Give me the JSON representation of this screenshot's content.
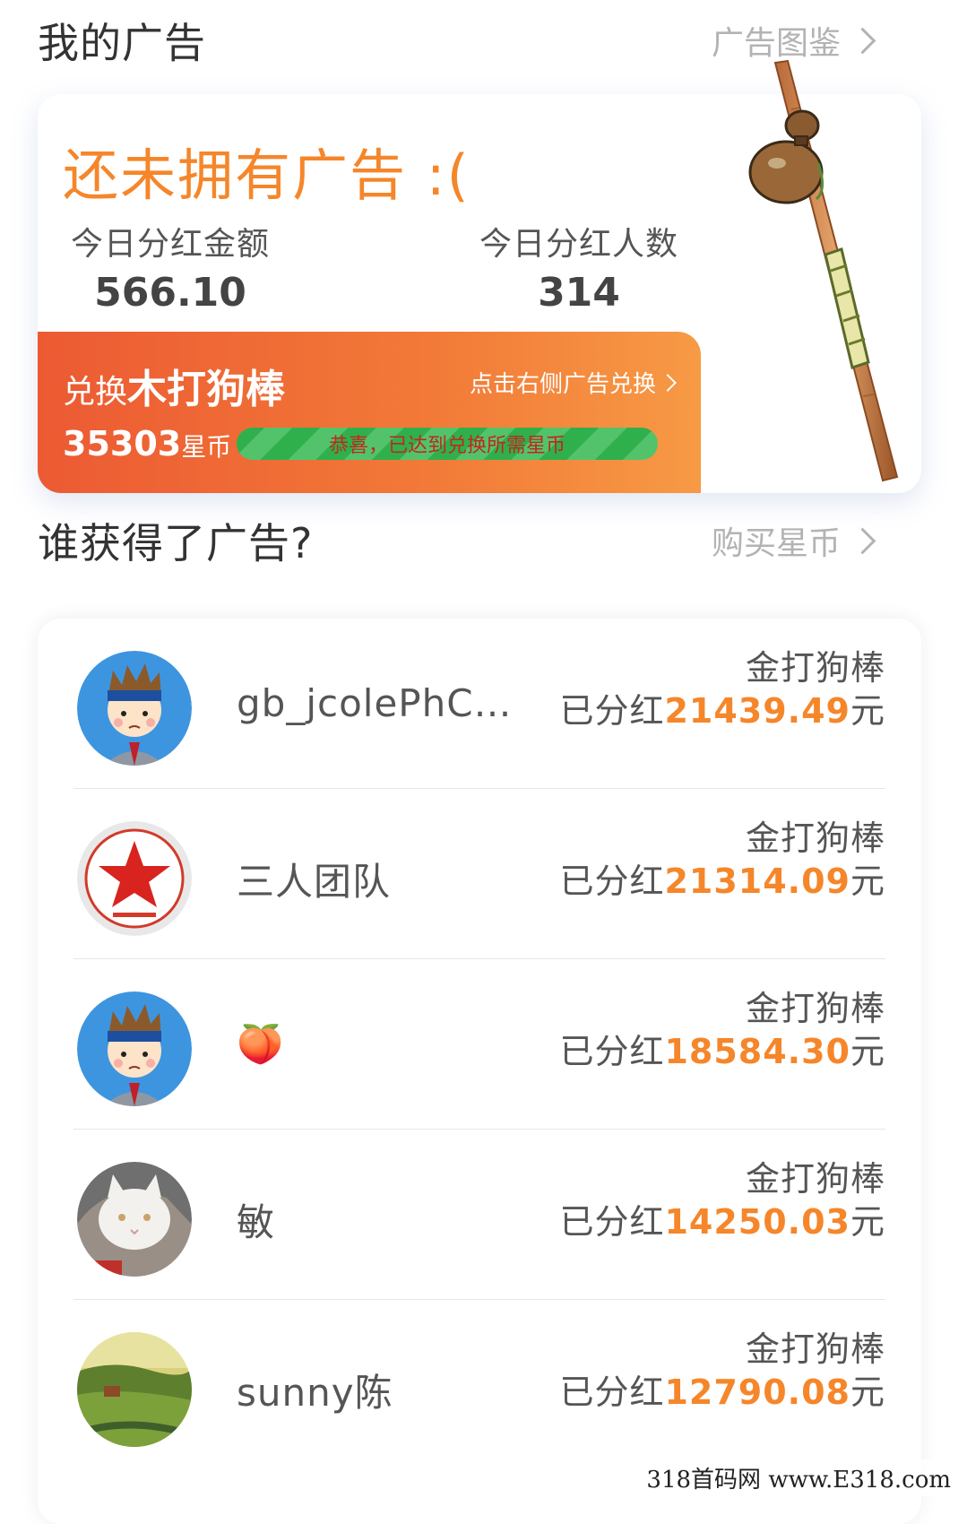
{
  "my_ads": {
    "title": "我的广告",
    "link": "广告图鉴",
    "empty_text": "还未拥有广告 :(",
    "stat_amount_label": "今日分红金额",
    "stat_amount_value": "566.10",
    "stat_people_label": "今日分红人数",
    "stat_people_value": "314",
    "exchange_prefix": "兑换",
    "exchange_item": "木打狗棒",
    "exchange_hint": "点击右侧广告兑换",
    "coins_value": "35303",
    "coins_unit": "星币",
    "progress_text": "恭喜，已达到兑换所需星币",
    "progress_fraction": 1.0
  },
  "winners": {
    "title": "谁获得了广告?",
    "link": "购买星币",
    "earned_prefix": "已分红",
    "earned_suffix": "元",
    "rows": [
      {
        "name": "gb_jcolePhC…",
        "ad_type": "金打狗棒",
        "amount": "21439.49",
        "avatar": "cartoon-boy"
      },
      {
        "name": "三人团队",
        "ad_type": "金打狗棒",
        "amount": "21314.09",
        "avatar": "red-star-badge"
      },
      {
        "name": "🍑",
        "ad_type": "金打狗棒",
        "amount": "18584.30",
        "avatar": "cartoon-boy"
      },
      {
        "name": "敏",
        "ad_type": "金打狗棒",
        "amount": "14250.03",
        "avatar": "white-cat-photo"
      },
      {
        "name": "sunny陈",
        "ad_type": "金打狗棒",
        "amount": "12790.08",
        "avatar": "landscape-photo"
      }
    ]
  },
  "watermark": "318首码网 www.E318.com",
  "colors": {
    "accent": "#f5862a",
    "exchange_start": "#ec5a33",
    "exchange_end": "#f79a45",
    "progress_green": "#2fb04c"
  }
}
